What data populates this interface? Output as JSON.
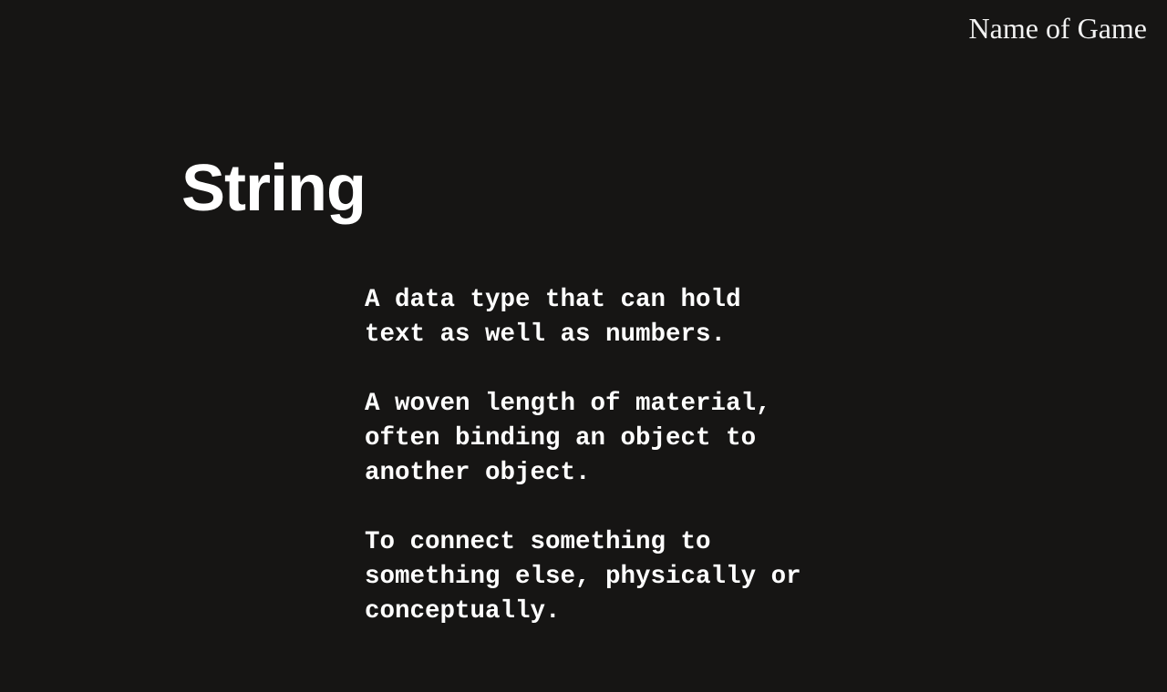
{
  "header": {
    "game_name": "Name of Game"
  },
  "card": {
    "term": "String",
    "definitions": [
      "A data type that can hold text as well as numbers.",
      "A woven length of material, often binding an object to another object.",
      "To connect something to something else, physically or conceptually."
    ]
  },
  "colors": {
    "background": "#161514",
    "text": "#ffffff"
  }
}
